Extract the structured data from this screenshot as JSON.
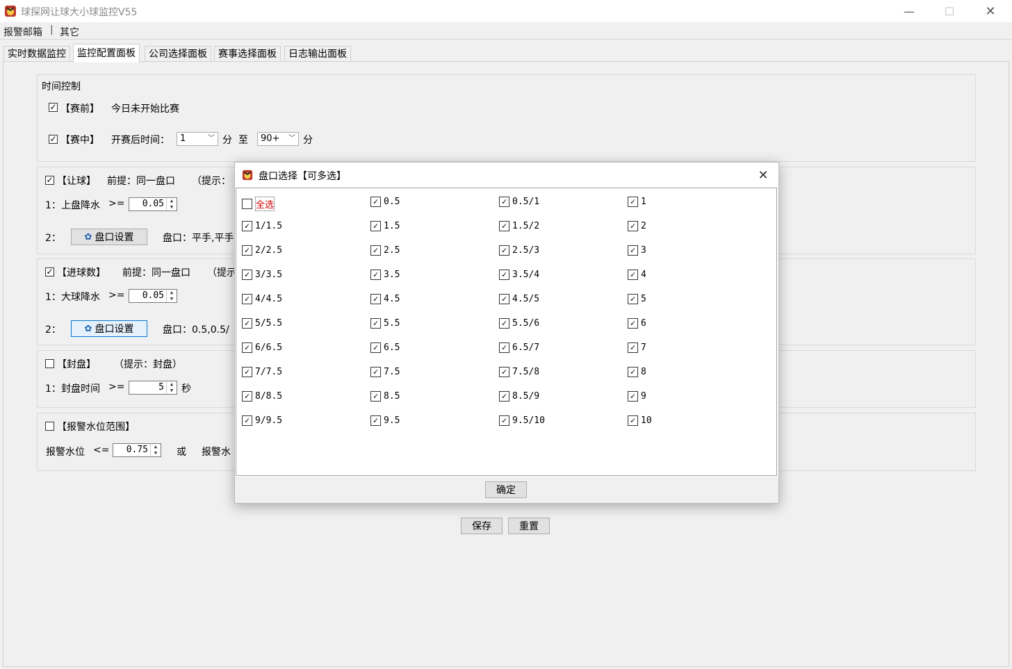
{
  "window": {
    "title": "球探网让球大小球监控V55",
    "minimize": "—",
    "maximize": "☐",
    "close": "✕"
  },
  "menu": {
    "items": [
      "报警邮箱",
      "其它"
    ],
    "separator": "|"
  },
  "tabs": [
    "实时数据监控",
    "监控配置面板",
    "公司选择面板",
    "赛事选择面板",
    "日志输出面板"
  ],
  "time_control": {
    "title": "时间控制",
    "prematch": {
      "checked": true,
      "label": "【赛前】",
      "desc": "今日未开始比赛"
    },
    "inplay": {
      "checked": true,
      "label": "【赛中】",
      "desc": "开赛后时间：",
      "from": "1",
      "unit1": "分",
      "to_word": "至",
      "to": "90+",
      "unit2": "分"
    }
  },
  "handicap": {
    "checked": true,
    "label": "【让球】",
    "premise": "前提：同一盘口",
    "hint": "（提示：",
    "row1_num": "1：",
    "row1_label": "上盘降水",
    "row1_op": ">=",
    "row1_value": "0.05",
    "row2_num": "2：",
    "button": "盘口设置",
    "odds": "盘口：平手,平手"
  },
  "goals": {
    "checked": true,
    "label": "【进球数】",
    "premise": "前提：同一盘口",
    "hint": "（提示",
    "row1_num": "1：",
    "row1_label": "大球降水",
    "row1_op": ">=",
    "row1_value": "0.05",
    "row2_num": "2：",
    "button": "盘口设置",
    "odds": "盘口：0.5,0.5/"
  },
  "closed": {
    "checked": false,
    "label": "【封盘】",
    "hint": "（提示：封盘）",
    "row1_num": "1：",
    "row1_label": "封盘时间",
    "row1_op": ">=",
    "row1_value": "5",
    "unit": "秒"
  },
  "alarm": {
    "checked": false,
    "label": "【报警水位范围】",
    "row_label": "报警水位",
    "op": "<=",
    "value": "0.75",
    "or": "或",
    "row_label2": "报警水"
  },
  "buttons": {
    "save": "保存",
    "reset": "重置"
  },
  "dialog": {
    "title": "盘口选择【可多选】",
    "close": "✕",
    "ok": "确定",
    "options": [
      {
        "label": "全选",
        "checked": false
      },
      {
        "label": "0.5",
        "checked": true
      },
      {
        "label": "0.5/1",
        "checked": true
      },
      {
        "label": "1",
        "checked": true
      },
      {
        "label": "1/1.5",
        "checked": true
      },
      {
        "label": "1.5",
        "checked": true
      },
      {
        "label": "1.5/2",
        "checked": true
      },
      {
        "label": "2",
        "checked": true
      },
      {
        "label": "2/2.5",
        "checked": true
      },
      {
        "label": "2.5",
        "checked": true
      },
      {
        "label": "2.5/3",
        "checked": true
      },
      {
        "label": "3",
        "checked": true
      },
      {
        "label": "3/3.5",
        "checked": true
      },
      {
        "label": "3.5",
        "checked": true
      },
      {
        "label": "3.5/4",
        "checked": true
      },
      {
        "label": "4",
        "checked": true
      },
      {
        "label": "4/4.5",
        "checked": true
      },
      {
        "label": "4.5",
        "checked": true
      },
      {
        "label": "4.5/5",
        "checked": true
      },
      {
        "label": "5",
        "checked": true
      },
      {
        "label": "5/5.5",
        "checked": true
      },
      {
        "label": "5.5",
        "checked": true
      },
      {
        "label": "5.5/6",
        "checked": true
      },
      {
        "label": "6",
        "checked": true
      },
      {
        "label": "6/6.5",
        "checked": true
      },
      {
        "label": "6.5",
        "checked": true
      },
      {
        "label": "6.5/7",
        "checked": true
      },
      {
        "label": "7",
        "checked": true
      },
      {
        "label": "7/7.5",
        "checked": true
      },
      {
        "label": "7.5",
        "checked": true
      },
      {
        "label": "7.5/8",
        "checked": true
      },
      {
        "label": "8",
        "checked": true
      },
      {
        "label": "8/8.5",
        "checked": true
      },
      {
        "label": "8.5",
        "checked": true
      },
      {
        "label": "8.5/9",
        "checked": true
      },
      {
        "label": "9",
        "checked": true
      },
      {
        "label": "9/9.5",
        "checked": true
      },
      {
        "label": "9.5",
        "checked": true
      },
      {
        "label": "9.5/10",
        "checked": true
      },
      {
        "label": "10",
        "checked": true
      }
    ]
  },
  "colors": {
    "app_icon": "#c0392b",
    "accent": "#0078d7",
    "select_all_text": "#d40000"
  }
}
